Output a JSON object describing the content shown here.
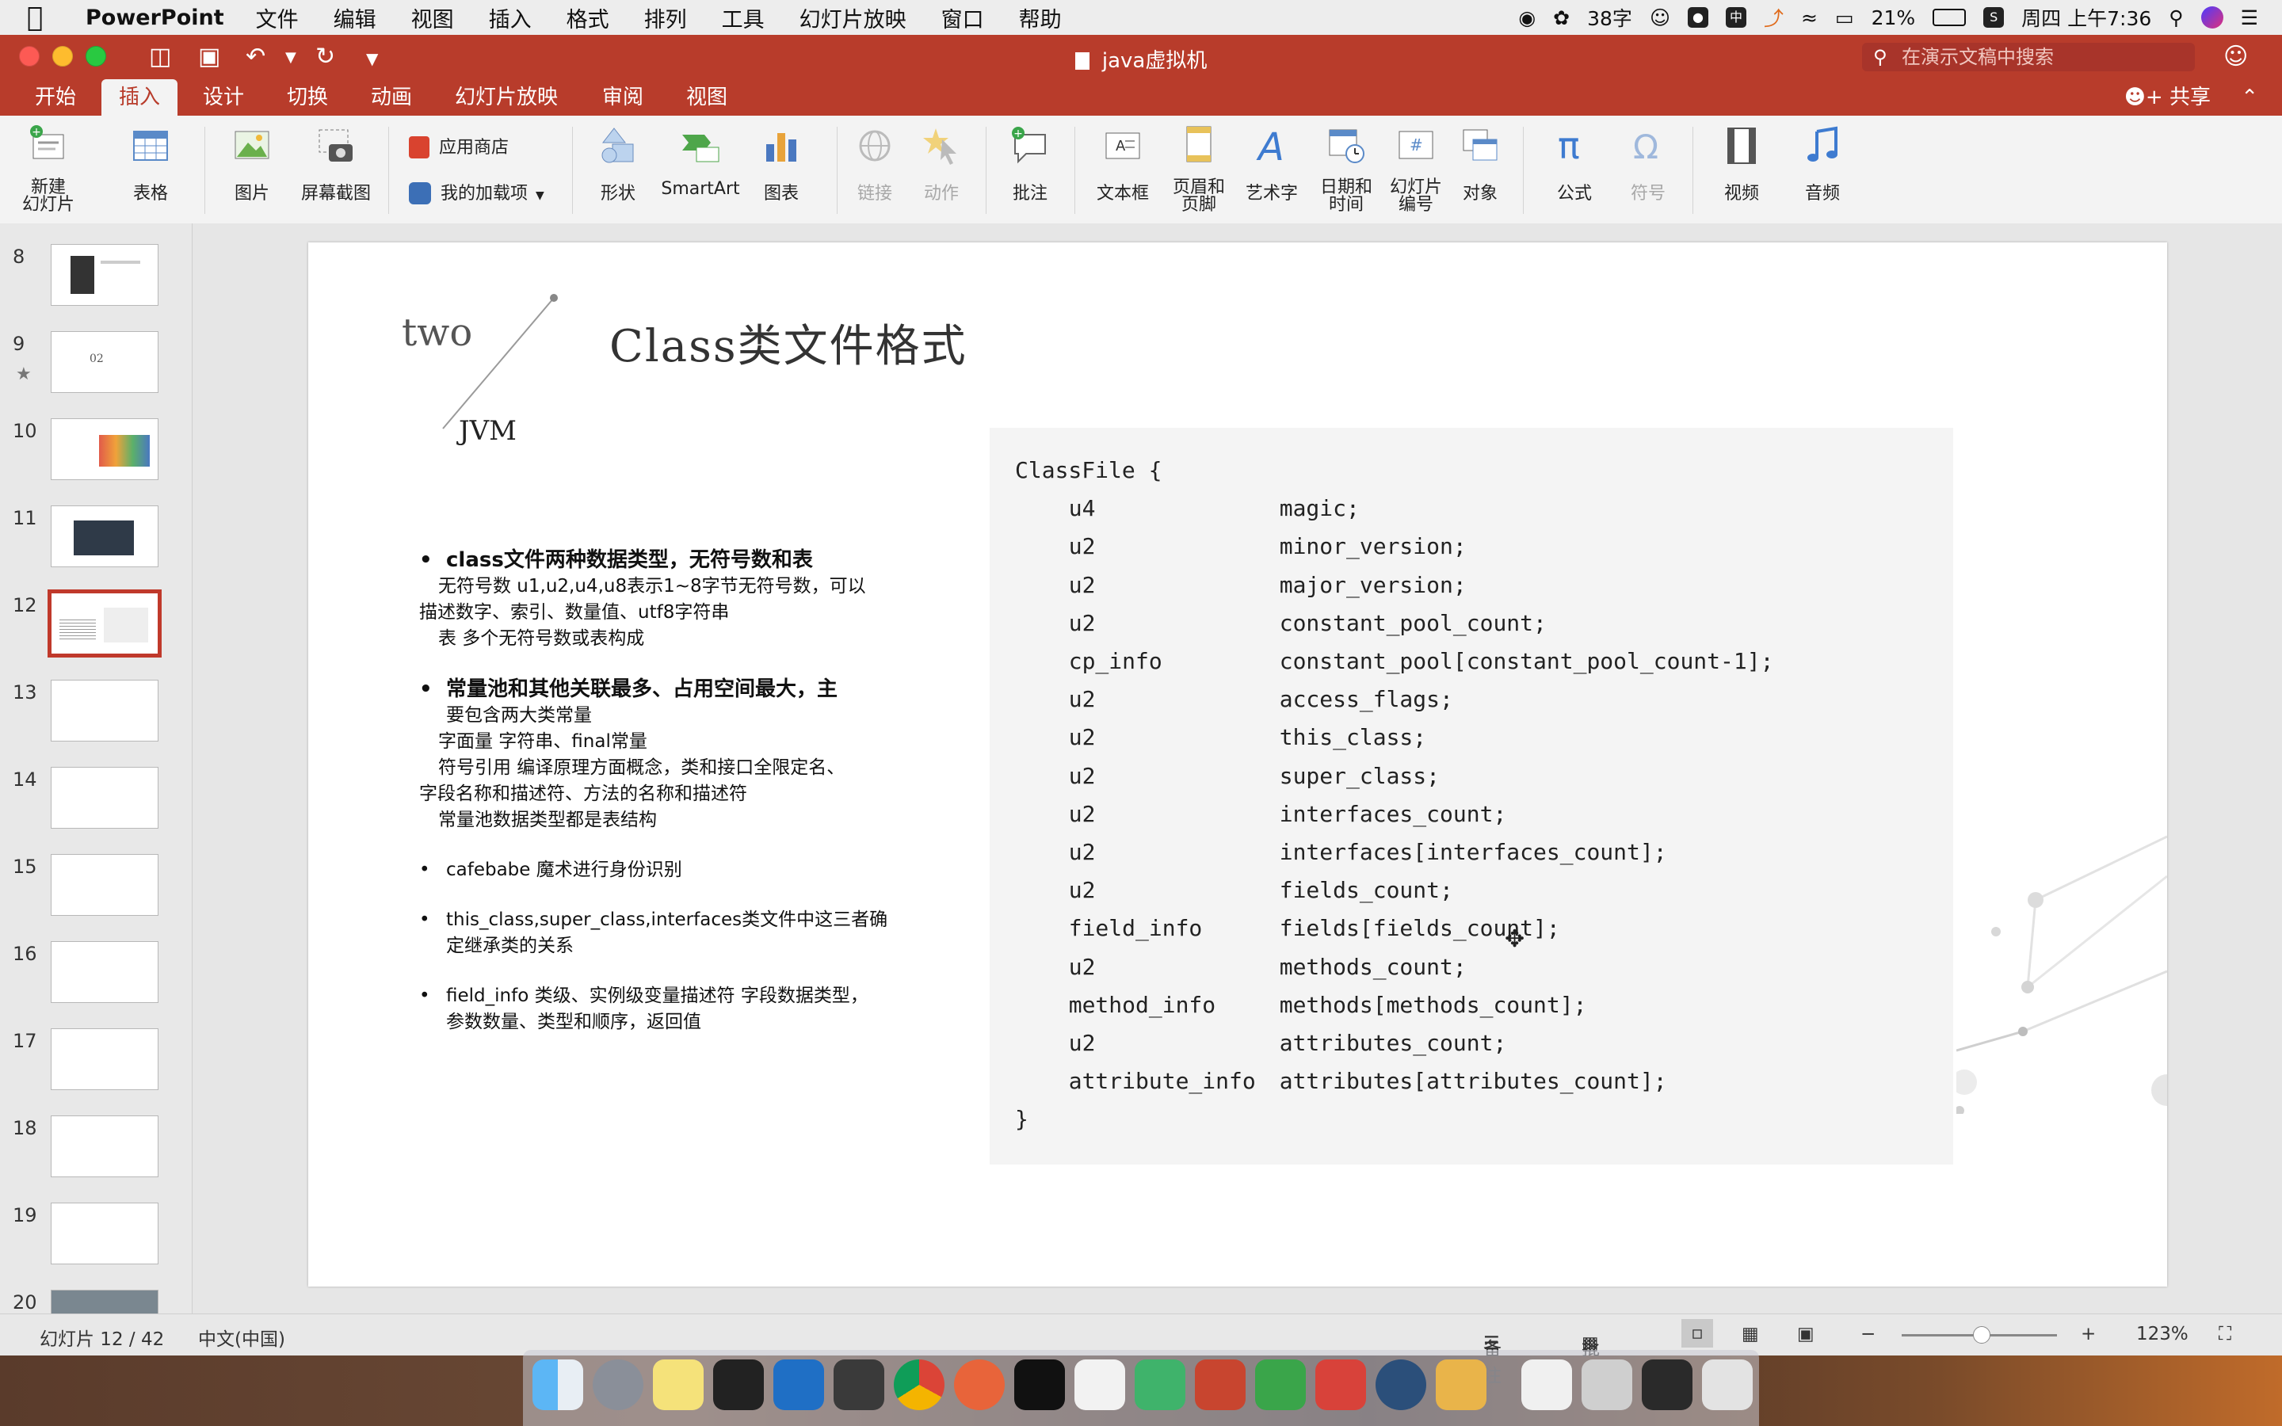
{
  "menubar": {
    "app": "PowerPoint",
    "items": [
      "文件",
      "编辑",
      "视图",
      "插入",
      "格式",
      "排列",
      "工具",
      "幻灯片放映",
      "窗口",
      "帮助"
    ],
    "status": {
      "word_count": "38字",
      "battery": "21%",
      "clock": "周四 上午7:36"
    }
  },
  "window": {
    "title": "java虚拟机",
    "search_placeholder": "在演示文稿中搜索"
  },
  "ribbon": {
    "tabs": [
      "开始",
      "插入",
      "设计",
      "切换",
      "动画",
      "幻灯片放映",
      "审阅",
      "视图"
    ],
    "active_tab": "插入",
    "share": "共享",
    "buttons": {
      "new_slide": "新建\n幻灯片",
      "table": "表格",
      "picture": "图片",
      "screenshot": "屏幕截图",
      "store": "应用商店",
      "addins": "我的加载项",
      "shapes": "形状",
      "smartart": "SmartArt",
      "chart": "图表",
      "link": "链接",
      "action": "动作",
      "comment": "批注",
      "textbox": "文本框",
      "header_footer": "页眉和\n页脚",
      "wordart": "艺术字",
      "datetime": "日期和\n时间",
      "slide_number": "幻灯片\n编号",
      "object": "对象",
      "equation": "公式",
      "symbol": "符号",
      "video": "视频",
      "audio": "音频"
    }
  },
  "thumbnails": {
    "numbers": [
      "8",
      "9",
      "10",
      "11",
      "12",
      "13",
      "14",
      "15",
      "16",
      "17",
      "18",
      "19",
      "20"
    ],
    "selected": "12",
    "thumb9_text": "02"
  },
  "slide": {
    "label_two": "two",
    "label_jvm": "JVM",
    "title": "Class类文件格式",
    "bullets": {
      "b1": "class文件两种数据类型，无符号数和表",
      "b1_l1": "无符号数 u1,u2,u4,u8表示1~8字节无符号数，可以",
      "b1_l2": "描述数字、索引、数量值、utf8字符串",
      "b1_l3": "表 多个无符号数或表构成",
      "b2_l1": "常量池和其他关联最多、占用空间最大，主",
      "b2_l2": "要包含两大类常量",
      "b2_l3": "字面量 字符串、final常量",
      "b2_l4": "符号引用 编译原理方面概念，类和接口全限定名、",
      "b2_l5": "字段名称和描述符、方法的名称和描述符",
      "b2_l6": "常量池数据类型都是表结构",
      "b3": "cafebabe 魔术进行身份识别",
      "b4_l1": "this_class,super_class,interfaces类文件中这三者确",
      "b4_l2": "定继承类的关系",
      "b5_l1": "field_info 类级、实例级变量描述符 字段数据类型，",
      "b5_l2": "参数数量、类型和顺序，返回值"
    },
    "code": {
      "open": "ClassFile {",
      "close": "}",
      "rows": [
        {
          "type": "u4",
          "field": "magic;"
        },
        {
          "type": "u2",
          "field": "minor_version;"
        },
        {
          "type": "u2",
          "field": "major_version;"
        },
        {
          "type": "u2",
          "field": "constant_pool_count;"
        },
        {
          "type": "cp_info",
          "field": "constant_pool[constant_pool_count-1];"
        },
        {
          "type": "u2",
          "field": "access_flags;"
        },
        {
          "type": "u2",
          "field": "this_class;"
        },
        {
          "type": "u2",
          "field": "super_class;"
        },
        {
          "type": "u2",
          "field": "interfaces_count;"
        },
        {
          "type": "u2",
          "field": "interfaces[interfaces_count];"
        },
        {
          "type": "u2",
          "field": "fields_count;"
        },
        {
          "type": "field_info",
          "field": "fields[fields_count];"
        },
        {
          "type": "u2",
          "field": "methods_count;"
        },
        {
          "type": "method_info",
          "field": "methods[methods_count];"
        },
        {
          "type": "u2",
          "field": "attributes_count;"
        },
        {
          "type": "attribute_info",
          "field": "attributes[attributes_count];"
        }
      ]
    }
  },
  "statusbar": {
    "slide_pos": "幻灯片 12 / 42",
    "language": "中文(中国)",
    "notes": "备注",
    "comments": "批注",
    "zoom": "123%"
  },
  "colors": {
    "brand": "#b83c2b",
    "selection": "#c0392b"
  }
}
